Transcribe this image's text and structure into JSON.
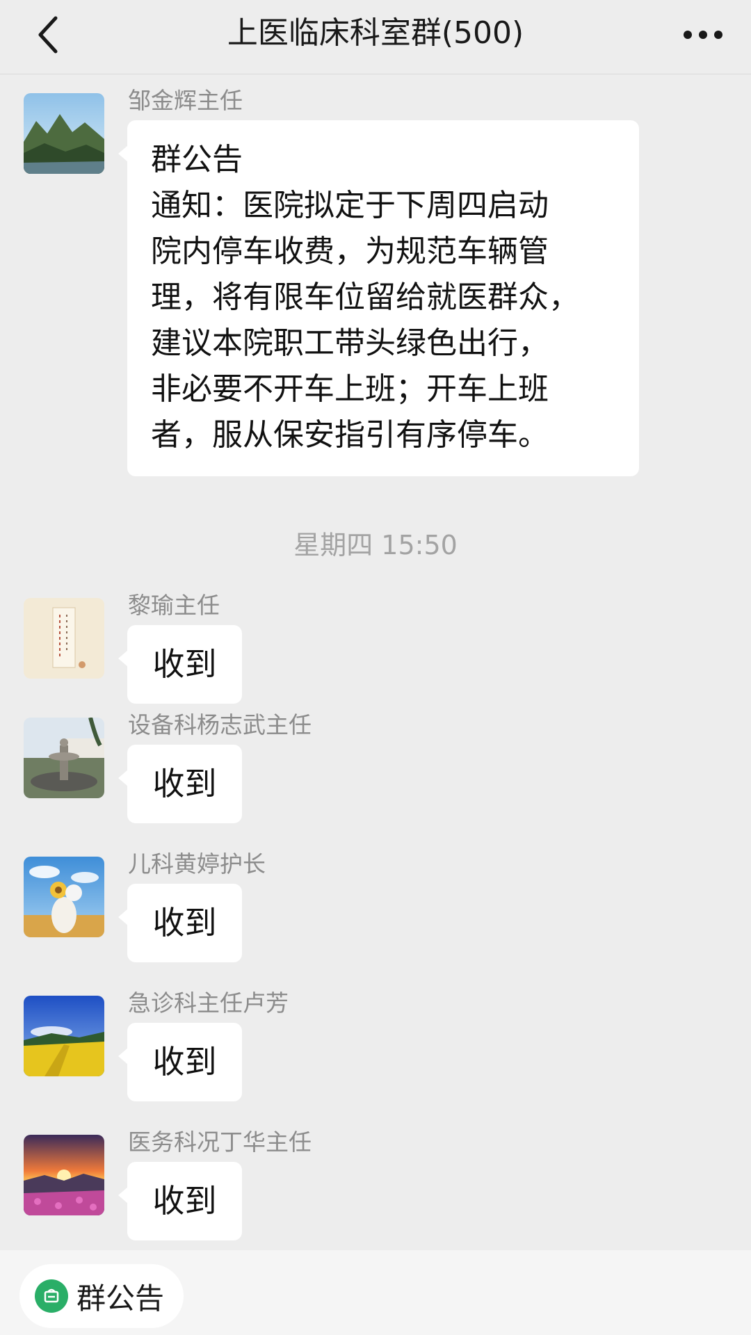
{
  "header": {
    "title": "上医临床科室群(500)",
    "back_icon": "chevron-left-icon",
    "more_icon": "more-dots-icon"
  },
  "messages": [
    {
      "sender": "邹金辉主任",
      "avatar": "mountain-landscape-avatar",
      "type": "notice",
      "title": "群公告",
      "text": "通知：医院拟定于下周四启动\n院内停车收费，为规范车辆管\n理，将有限车位留给就医群众，\n建议本院职工带头绿色出行，\n非必要不开车上班；开车上班\n者，服从保安指引有序停车。"
    },
    {
      "sender": "黎瑜主任",
      "avatar": "calligraphy-avatar",
      "text": "收到"
    },
    {
      "sender": "设备科杨志武主任",
      "avatar": "fountain-avatar",
      "text": "收到"
    },
    {
      "sender": "儿科黄婷护长",
      "avatar": "flowers-sky-avatar",
      "text": "收到"
    },
    {
      "sender": "急诊科主任卢芳",
      "avatar": "rapeseed-field-avatar",
      "text": "收到"
    },
    {
      "sender": "医务科况丁华主任",
      "avatar": "sunset-flowers-avatar",
      "text": "收到"
    }
  ],
  "time_divider": "星期四 15:50",
  "bottom_bar": {
    "notice_label": "群公告",
    "notice_icon": "announcement-icon"
  },
  "colors": {
    "background": "#ededed",
    "bubble": "#ffffff",
    "accent_green": "#2aae67",
    "secondary_text": "#8c8c8c"
  }
}
